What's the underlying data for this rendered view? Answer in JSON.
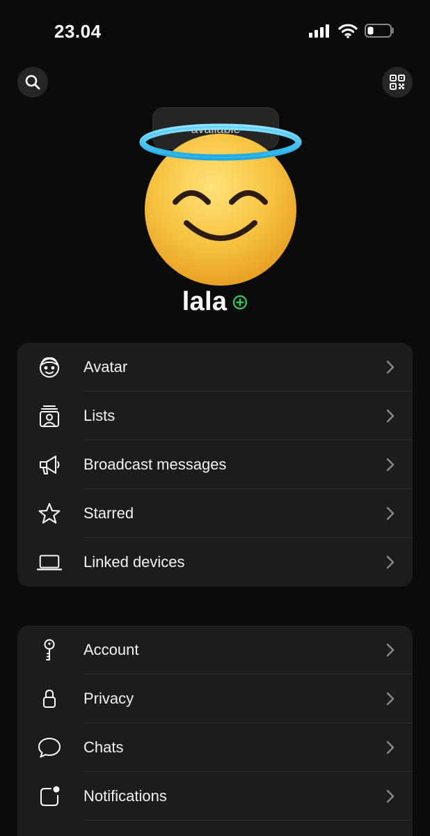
{
  "status_bar": {
    "time": "23.04"
  },
  "profile": {
    "status_text": "available",
    "name": "lala"
  },
  "colors": {
    "background": "#0b0b0b",
    "card": "#1c1c1c",
    "accent_green": "#25d366",
    "halo": "#3fc3f5"
  },
  "menu_group_1": [
    {
      "icon": "avatar-icon",
      "label": "Avatar"
    },
    {
      "icon": "lists-icon",
      "label": "Lists"
    },
    {
      "icon": "megaphone-icon",
      "label": "Broadcast messages"
    },
    {
      "icon": "star-icon",
      "label": "Starred"
    },
    {
      "icon": "laptop-icon",
      "label": "Linked devices"
    }
  ],
  "menu_group_2": [
    {
      "icon": "key-icon",
      "label": "Account"
    },
    {
      "icon": "lock-icon",
      "label": "Privacy"
    },
    {
      "icon": "chat-bubble-icon",
      "label": "Chats"
    },
    {
      "icon": "notification-icon",
      "label": "Notifications"
    }
  ]
}
